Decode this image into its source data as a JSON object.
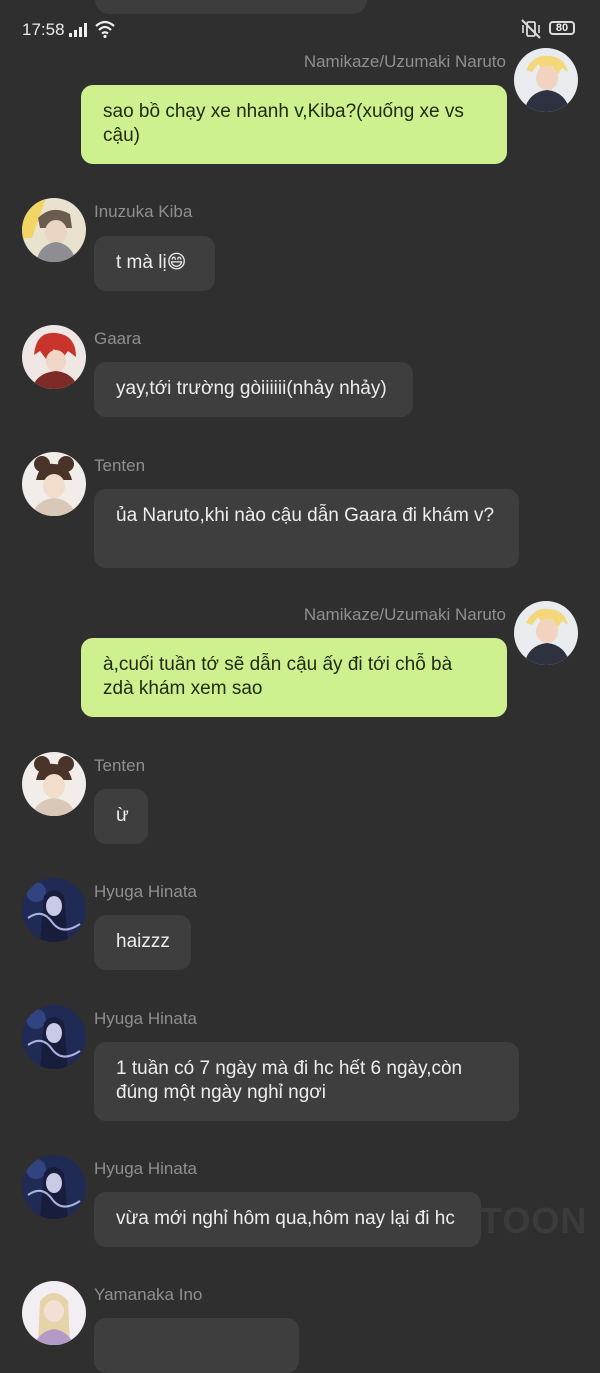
{
  "status_bar": {
    "time": "17:58",
    "battery": "80"
  },
  "watermark": "TOON",
  "messages": [
    {
      "sender": "Namikaze/Uzumaki Naruto",
      "text": "sao bồ chạy xe nhanh v,Kiba?(xuống xe vs cậu)"
    },
    {
      "sender": "Inuzuka Kiba",
      "text": "t mà lị😄"
    },
    {
      "sender": "Gaara",
      "text": "yay,tới trường gòiiiiii(nhảy nhảy)"
    },
    {
      "sender": "Tenten",
      "text": "ủa Naruto,khi nào cậu dẫn Gaara đi khám v?"
    },
    {
      "sender": "Namikaze/Uzumaki Naruto",
      "text": "à,cuối tuần tớ sẽ dẫn cậu ấy đi tới chỗ bà zdà khám xem sao"
    },
    {
      "sender": "Tenten",
      "text": "ừ"
    },
    {
      "sender": "Hyuga Hinata",
      "text": "haizzz"
    },
    {
      "sender": "Hyuga Hinata",
      "text": "1 tuần có 7 ngày mà đi hc hết 6 ngày,còn đúng một ngày nghỉ ngơi"
    },
    {
      "sender": "Hyuga Hinata",
      "text": "vừa mới nghỉ hôm qua,hôm nay lại đi hc"
    },
    {
      "sender": "Yamanaka Ino",
      "text": ""
    }
  ],
  "colors": {
    "background": "#2f2f2f",
    "incoming_bubble": "#3e3e3e",
    "outgoing_bubble": "#cff08f",
    "sender_name": "#8f8f8f"
  }
}
